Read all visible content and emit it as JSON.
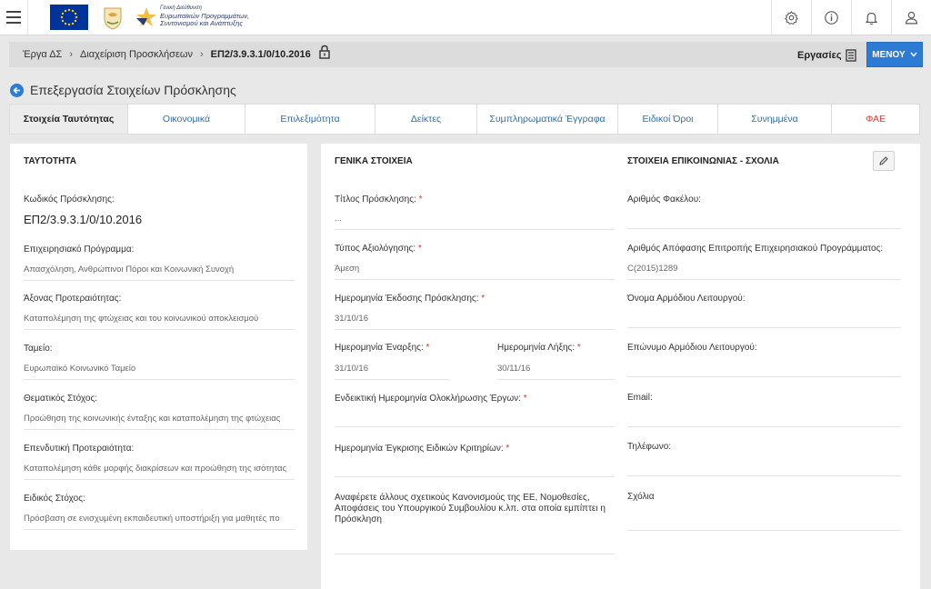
{
  "header": {
    "logo_text_line1": "Γενική Διεύθυνση",
    "logo_text_line2": "Ευρωπαϊκών Προγραμμάτων,",
    "logo_text_line3": "Συντονισμού και Ανάπτυξης",
    "icons": [
      "menu-icon",
      "gear-icon",
      "info-icon",
      "bell-icon",
      "user-icon"
    ]
  },
  "breadcrumb": {
    "items": [
      "Έργα ΔΣ",
      "Διαχείριση Προσκλήσεων"
    ],
    "current": "ΕΠ2/3.9.3.1/0/10.2016",
    "tasks_label": "Εργασίες",
    "menu_label": "ΜΕΝΟΥ"
  },
  "page": {
    "title": "Επεξεργασία Στοιχείων Πρόσκλησης"
  },
  "tabs": [
    {
      "label": "Στοιχεία Ταυτότητας"
    },
    {
      "label": "Οικονομικά"
    },
    {
      "label": "Επιλεξιμότητα"
    },
    {
      "label": "Δείκτες"
    },
    {
      "label": "Συμπληρωματικά Έγγραφα"
    },
    {
      "label": "Ειδικοί Όροι"
    },
    {
      "label": "Συνημμένα"
    },
    {
      "label": "ΦΑΕ"
    }
  ],
  "identity": {
    "title": "ΤΑΥΤΟΤΗΤΑ",
    "fields": [
      {
        "label": "Κωδικός Πρόσκλησης:",
        "value": "ΕΠ2/3.9.3.1/0/10.2016"
      },
      {
        "label": "Επιχειρησιακό Πρόγραμμα:",
        "value": "Απασχόληση, Ανθρώπινοι Πόροι και Κοινωνική Συνοχή"
      },
      {
        "label": "Άξονας Προτεραιότητας:",
        "value": "Καταπολέμηση της φτώχειας και του κοινωνικού αποκλεισμού"
      },
      {
        "label": "Ταμείο:",
        "value": "Ευρωπαϊκό Κοινωνικό Ταμείο"
      },
      {
        "label": "Θεματικός Στόχος:",
        "value": "Προώθηση της κοινωνικής ένταξης και καταπολέμηση της φτώχειας"
      },
      {
        "label": "Επενδυτική Προτεραιότητα:",
        "value": "Καταπολέμηση κάθε μορφής διακρίσεων και προώθηση της ισότητας"
      },
      {
        "label": "Ειδικός Στόχος:",
        "value": "Πρόσβαση σε ενισχυμένη εκπαιδευτική υποστήριξη για μαθητές πο"
      }
    ]
  },
  "general": {
    "title": "ΓΕΝΙΚΑ ΣΤΟΙΧΕΙΑ",
    "title_label": "Τίτλος Πρόσκλησης:",
    "title_value": "...",
    "eval_label": "Τύπος Αξιολόγησης:",
    "eval_value": "Άμεση",
    "issue_label": "Ημερομηνία Έκδοσης Πρόσκλησης:",
    "issue_value": "31/10/16",
    "start_label": "Ημερομηνία Έναρξης:",
    "start_value": "31/10/16",
    "end_label": "Ημερομηνία Λήξης:",
    "end_value": "30/11/16",
    "completion_label": "Ενδεικτική Ημερομηνία Ολοκλήρωσης Έργων:",
    "completion_value": "",
    "criteria_label": "Ημερομηνία Έγκρισης Ειδικών Κριτηρίων:",
    "criteria_value": "",
    "regulations_label": "Αναφέρετε άλλους σχετικούς Κανονισμούς της ΕΕ, Νομοθεσίες, Αποφάσεις του Υπουργικού Συμβουλίου κ.λπ. στα οποία εμπίπτει η Πρόσκληση",
    "required_mark": "*"
  },
  "contact": {
    "title": "ΣΤΟΙΧΕΙΑ ΕΠΙΚΟΙΝΩΝΙΑΣ - ΣΧΟΛΙΑ",
    "folder_label": "Αριθμός Φακέλου:",
    "folder_value": "",
    "decision_label": "Αριθμός Απόφασης Επιτροπής Επιχειρησιακού Προγράμματος:",
    "decision_value": "C(2015)1289",
    "officer_name_label": "Όνομα Αρμόδιου Λειτουργού:",
    "officer_name_value": "",
    "officer_surname_label": "Επώνυμο Αρμόδιου Λειτουργού:",
    "officer_surname_value": "",
    "email_label": "Email:",
    "email_value": "",
    "phone_label": "Τηλέφωνο:",
    "phone_value": "",
    "comments_label": "Σχόλια",
    "comments_value": ""
  },
  "colors": {
    "accent": "#2d7bd4",
    "required": "#d33333",
    "fae_tab": "#e23b2e"
  }
}
